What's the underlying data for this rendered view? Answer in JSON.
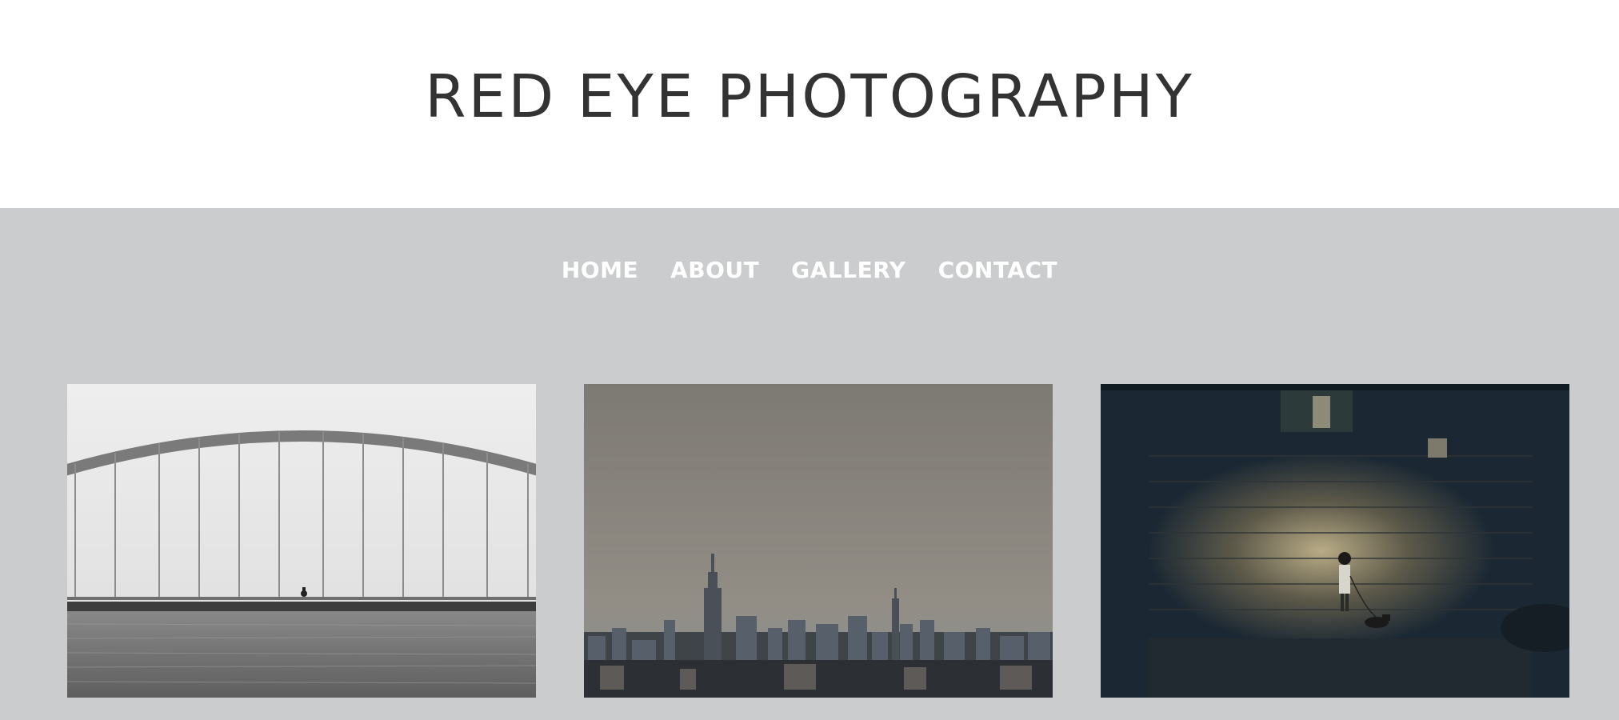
{
  "header": {
    "site_title": "RED EYE PHOTOGRAPHY"
  },
  "nav": {
    "items": [
      {
        "label": "HOME"
      },
      {
        "label": "ABOUT"
      },
      {
        "label": "GALLERY"
      },
      {
        "label": "CONTACT"
      }
    ]
  },
  "gallery": {
    "photos": [
      {
        "subject": "bridge-cyclist-photo"
      },
      {
        "subject": "city-skyline-photo"
      },
      {
        "subject": "boy-with-dog-spotlight-photo"
      }
    ]
  },
  "colors": {
    "title_text": "#333333",
    "band_background": "#cbcccd",
    "nav_text": "#ffffff"
  }
}
